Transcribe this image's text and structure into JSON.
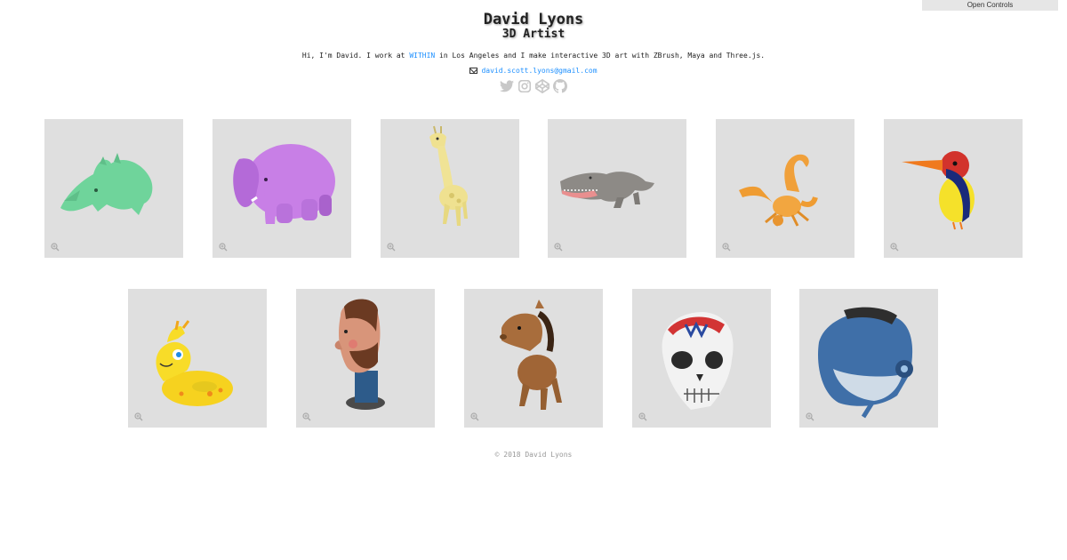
{
  "controls": {
    "label": "Open Controls"
  },
  "header": {
    "name": "David Lyons",
    "role": "3D Artist",
    "intro_before": "Hi, I'm David. I work at ",
    "intro_link": "WITHIN",
    "intro_after": " in Los Angeles and I make interactive 3D art with ZBrush, Maya and Three.js.",
    "email": "david.scott.lyons@gmail.com",
    "email_icon": "envelope-icon",
    "social": [
      "twitter-icon",
      "instagram-icon",
      "codepen-icon",
      "github-icon"
    ]
  },
  "gallery": {
    "row1": [
      "rhino",
      "elephant",
      "giraffe",
      "crocodile",
      "scorpion",
      "kingfisher"
    ],
    "row2": [
      "inflatable-giraffe-ring",
      "bearded-man-bust",
      "horse",
      "skull",
      "helmet"
    ]
  },
  "footer": {
    "copyright": "© 2018 David Lyons"
  },
  "colors": {
    "link": "#1e90ff",
    "tile_bg": "#dfdfdf",
    "social_icon": "#c8c8c8"
  }
}
